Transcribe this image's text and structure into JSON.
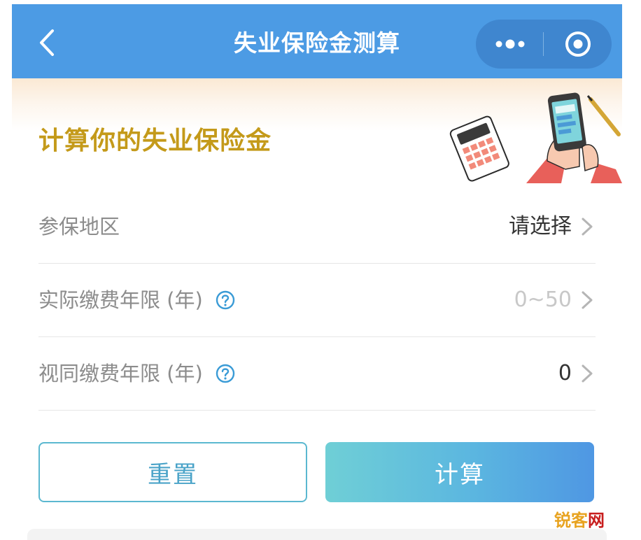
{
  "navbar": {
    "title": "失业保险金测算",
    "back_icon": "chevron-left-icon",
    "more_icon": "more-dots-icon",
    "close_icon": "target-circle-icon",
    "background": "#4c9be4"
  },
  "banner": {
    "title": "计算你的失业保险金",
    "title_color": "#c49a1a"
  },
  "form": {
    "rows": [
      {
        "label": "参保地区",
        "value": "请选择",
        "has_help": false,
        "is_placeholder": false
      },
      {
        "label": "实际缴费年限 (年)",
        "value": "0~50",
        "has_help": true,
        "is_placeholder": true
      },
      {
        "label": "视同缴费年限 (年)",
        "value": "0",
        "has_help": true,
        "is_placeholder": false
      }
    ]
  },
  "actions": {
    "reset_label": "重置",
    "calculate_label": "计算",
    "accent_color": "#4aa3c8"
  },
  "watermark": {
    "part1": "锐客",
    "part2": "网"
  }
}
